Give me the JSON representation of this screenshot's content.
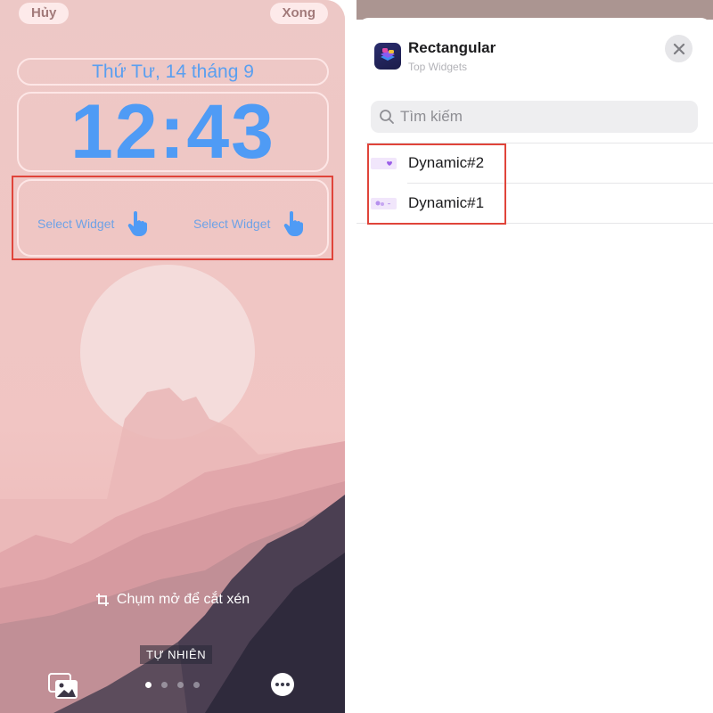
{
  "lock_screen": {
    "cancel_label": "Hủy",
    "done_label": "Xong",
    "date": "Thứ Tư, 14 tháng 9",
    "time": "12:43",
    "widget_slots": [
      {
        "label": "Select Widget",
        "icon": "hand-pointer-icon"
      },
      {
        "label": "Select Widget",
        "icon": "hand-pointer-icon"
      }
    ],
    "crop_hint": "Chụm mở để cắt xén",
    "style_label": "TỰ NHIÊN",
    "page_count": 4,
    "active_page": 1,
    "colors": {
      "clock": "#4f9bf5",
      "highlight": "#e0443a"
    }
  },
  "widget_sheet": {
    "app_name": "Rectangular",
    "app_developer": "Top Widgets",
    "search_placeholder": "Tìm kiếm",
    "items": [
      {
        "label": "Dynamic#2",
        "thumb": "heart-widget-thumbnail"
      },
      {
        "label": "Dynamic#1",
        "thumb": "dynamic-widget-thumbnail"
      }
    ]
  }
}
